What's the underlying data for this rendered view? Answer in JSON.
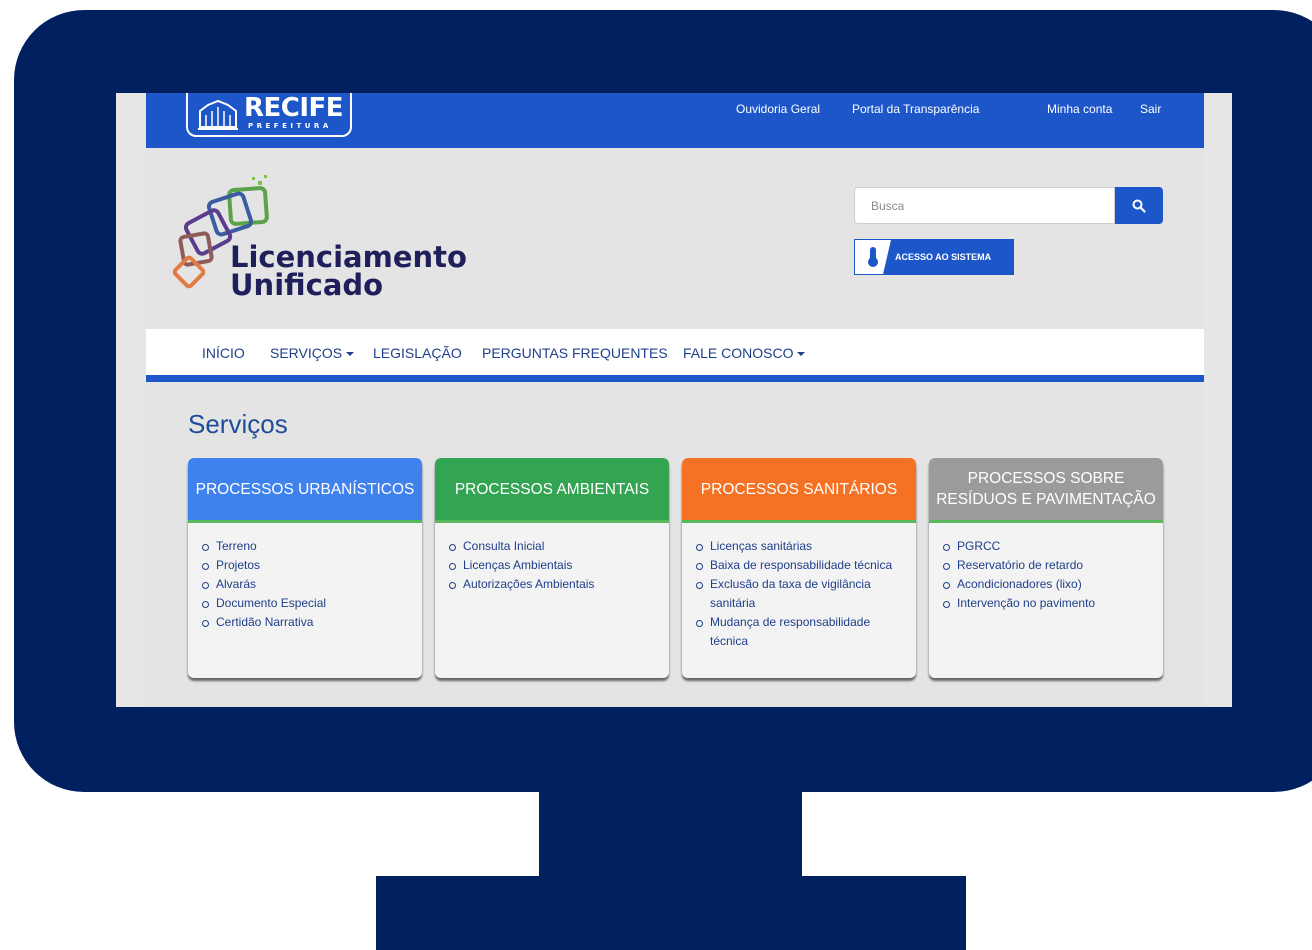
{
  "colors": {
    "monitor": "#00205f",
    "primary_blue": "#1d56c9",
    "title_blue": "#1e4e9a",
    "card_urbanisticos": "#3f82ee",
    "card_ambientais": "#33a552",
    "card_sanitarios": "#f57225",
    "card_residuos": "#9b9b9b"
  },
  "topbar": {
    "logo_text": "RECIFE",
    "logo_subtext": "PREFEITURA",
    "links": [
      "Ouvidoria Geral",
      "Portal da Transparência",
      "Minha conta",
      "Sair"
    ]
  },
  "brand": {
    "line1": "Licenciamento",
    "line2": "Unificado"
  },
  "search": {
    "placeholder": "Busca",
    "button_icon": "search-icon"
  },
  "access_button": {
    "label": "ACESSO AO SISTEMA",
    "icon": "thermometer-icon"
  },
  "nav": {
    "items": [
      "INÍCIO",
      "SERVIÇOS",
      "LEGISLAÇÃO",
      "PERGUNTAS FREQUENTES",
      "FALE CONOSCO"
    ]
  },
  "page": {
    "title": "Serviços"
  },
  "cards": [
    {
      "title": "PROCESSOS URBANÍSTICOS",
      "items": [
        "Terreno",
        "Projetos",
        "Alvarás",
        "Documento Especial",
        "Certidão Narrativa"
      ]
    },
    {
      "title": "PROCESSOS AMBIENTAIS",
      "items": [
        "Consulta Inicial",
        "Licenças Ambientais",
        "Autorizações Ambientais"
      ]
    },
    {
      "title": "PROCESSOS SANITÁRIOS",
      "items": [
        "Licenças sanitárias",
        "Baixa de responsabilidade técnica",
        "Exclusão da taxa de vigilância sanitária",
        "Mudança de responsabilidade técnica"
      ]
    },
    {
      "title": "PROCESSOS SOBRE RESÍDUOS E PAVIMENTAÇÃO",
      "items": [
        "PGRCC",
        "Reservatório de retardo",
        "Acondicionadores (lixo)",
        "Intervenção no pavimento"
      ]
    }
  ]
}
